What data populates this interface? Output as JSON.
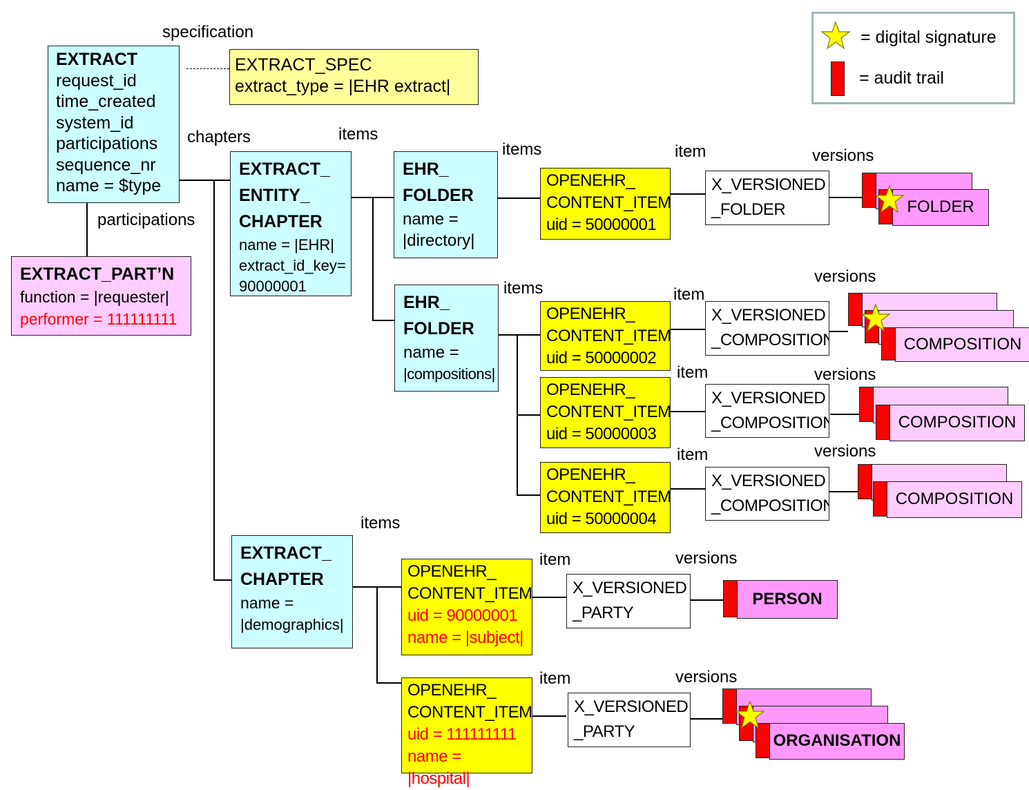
{
  "legend": {
    "signature": {
      "icon": "star-icon",
      "text": "= digital signature"
    },
    "audit": {
      "icon": "audit-trail-icon",
      "text": "= audit trail"
    }
  },
  "colors": {
    "object_box": "#ccffff",
    "content_item": "#ffff00",
    "spec": "#ffff99",
    "participation": "#ffccff",
    "version": "#ffccff",
    "party_version": "#ff99ff",
    "audit_trail": "#ff0000",
    "signature": "#ffff00",
    "highlight_text": "#ff0000"
  },
  "relationship_labels": {
    "specification": "specification",
    "chapters": "chapters",
    "participations": "participations",
    "items": "items",
    "item": "item",
    "versions": "versions"
  },
  "extract": {
    "title": "EXTRACT",
    "fields": [
      "request_id",
      "time_created",
      "system_id",
      "participations",
      "sequence_nr",
      "name = $type"
    ]
  },
  "extract_spec": {
    "title": "EXTRACT_SPEC",
    "fields": [
      "extract_type = |EHR extract|"
    ]
  },
  "extract_participation": {
    "title": "EXTRACT_PART’N",
    "fields": [
      "function = |requester|"
    ],
    "highlight_fields": [
      "performer = 111111111"
    ]
  },
  "entity_chapter": {
    "title_lines": [
      "EXTRACT_",
      "ENTITY_",
      "CHAPTER"
    ],
    "fields": [
      "name = |EHR|",
      "extract_id_key=",
      "90000001"
    ]
  },
  "folders": [
    {
      "title_lines": [
        "EHR_",
        "FOLDER"
      ],
      "fields": [
        "name =",
        "|directory|"
      ]
    },
    {
      "title_lines": [
        "EHR_",
        "FOLDER"
      ],
      "fields": [
        "name =",
        "|compositions|"
      ]
    }
  ],
  "content_items": [
    {
      "lines": [
        "OPENEHR_",
        "CONTENT_ITEM",
        "uid = 50000001"
      ],
      "highlight": []
    },
    {
      "lines": [
        "OPENEHR_",
        "CONTENT_ITEM",
        "uid = 50000002"
      ],
      "highlight": []
    },
    {
      "lines": [
        "OPENEHR_",
        "CONTENT_ITEM",
        "uid = 50000003"
      ],
      "highlight": []
    },
    {
      "lines": [
        "OPENEHR_",
        "CONTENT_ITEM",
        "uid = 50000004"
      ],
      "highlight": []
    },
    {
      "lines": [
        "OPENEHR_",
        "CONTENT_ITEM"
      ],
      "highlight": [
        "uid = 90000001",
        "name = |subject|"
      ]
    },
    {
      "lines": [
        "OPENEHR_",
        "CONTENT_ITEM"
      ],
      "highlight": [
        "uid = 111111111",
        "name = |hospital|"
      ]
    }
  ],
  "versioned": [
    {
      "lines": [
        "X_VERSIONED",
        "_FOLDER"
      ]
    },
    {
      "lines": [
        "X_VERSIONED",
        "_COMPOSITION"
      ]
    },
    {
      "lines": [
        "X_VERSIONED",
        "_COMPOSITION"
      ]
    },
    {
      "lines": [
        "X_VERSIONED",
        "_COMPOSITION"
      ]
    },
    {
      "lines": [
        "X_VERSIONED",
        "_PARTY"
      ]
    },
    {
      "lines": [
        "X_VERSIONED",
        "_PARTY"
      ]
    }
  ],
  "version_stacks": [
    {
      "label": "FOLDER",
      "count": 2,
      "signed": true
    },
    {
      "label": "COMPOSITION",
      "count": 3,
      "signed": true
    },
    {
      "label": "COMPOSITION",
      "count": 2,
      "signed": false
    },
    {
      "label": "COMPOSITION",
      "count": 2,
      "signed": false
    },
    {
      "label": "PERSON",
      "count": 1,
      "signed": false
    },
    {
      "label": "ORGANISATION",
      "count": 3,
      "signed": true
    }
  ],
  "demographics_chapter": {
    "title_lines": [
      "EXTRACT_",
      "CHAPTER"
    ],
    "fields": [
      "name =",
      "|demographics|"
    ]
  }
}
